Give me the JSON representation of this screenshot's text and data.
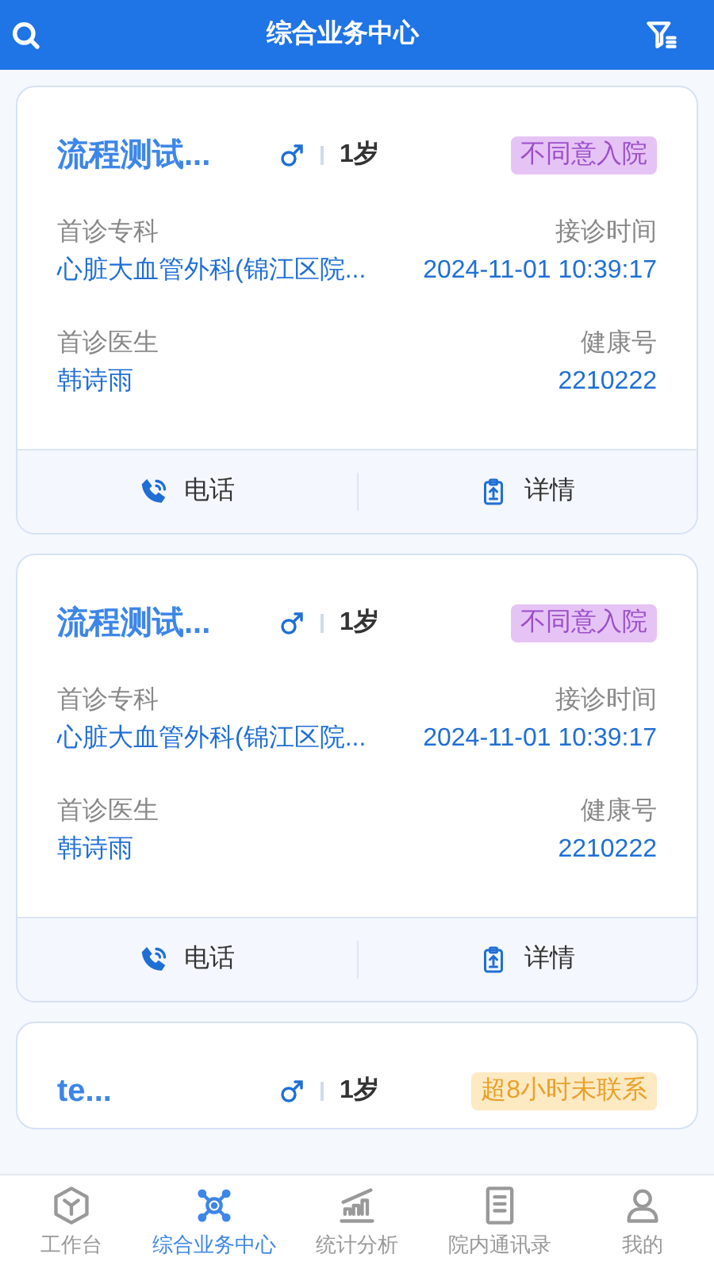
{
  "header": {
    "title": "综合业务中心"
  },
  "cards": [
    {
      "name": "流程测试...",
      "age": "1岁",
      "status": {
        "text": "不同意入院",
        "kind": "refused"
      },
      "fields": [
        {
          "label": "首诊专科",
          "value": "心脏大血管外科(锦江区院..."
        },
        {
          "label": "接诊时间",
          "value": "2024-11-01 10:39:17"
        },
        {
          "label": "首诊医生",
          "value": "韩诗雨"
        },
        {
          "label": "健康号",
          "value": "2210222"
        }
      ],
      "actions": [
        {
          "label": "电话",
          "kind": "phone"
        },
        {
          "label": "详情",
          "kind": "detail"
        }
      ]
    },
    {
      "name": "流程测试...",
      "age": "1岁",
      "status": {
        "text": "不同意入院",
        "kind": "refused"
      },
      "fields": [
        {
          "label": "首诊专科",
          "value": "心脏大血管外科(锦江区院..."
        },
        {
          "label": "接诊时间",
          "value": "2024-11-01 10:39:17"
        },
        {
          "label": "首诊医生",
          "value": "韩诗雨"
        },
        {
          "label": "健康号",
          "value": "2210222"
        }
      ],
      "actions": [
        {
          "label": "电话",
          "kind": "phone"
        },
        {
          "label": "详情",
          "kind": "detail"
        }
      ]
    },
    {
      "name": "te...",
      "age": "1岁",
      "status": {
        "text": "超8小时未联系",
        "kind": "overdue"
      }
    }
  ],
  "tabbar": [
    {
      "label": "工作台",
      "selected": false,
      "kind": "workbench"
    },
    {
      "label": "综合业务中心",
      "selected": true,
      "kind": "hub"
    },
    {
      "label": "统计分析",
      "selected": false,
      "kind": "stats"
    },
    {
      "label": "院内通讯录",
      "selected": false,
      "kind": "contacts"
    },
    {
      "label": "我的",
      "selected": false,
      "kind": "me"
    }
  ]
}
